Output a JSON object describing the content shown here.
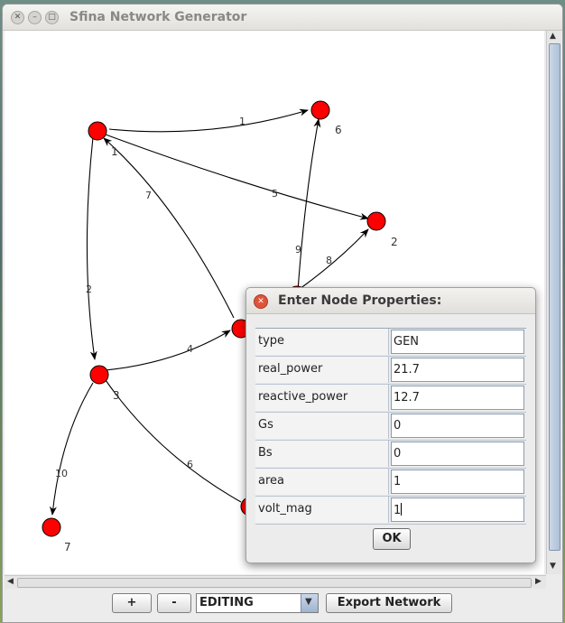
{
  "window": {
    "title": "Sfina Network Generator"
  },
  "graph": {
    "nodes": [
      {
        "id": "1",
        "label": "1"
      },
      {
        "id": "6",
        "label": "6"
      },
      {
        "id": "2",
        "label": "2"
      },
      {
        "id": "3",
        "label": "3"
      },
      {
        "id": "7",
        "label": "7"
      },
      {
        "id": "4",
        "label": ""
      },
      {
        "id": "5",
        "label": ""
      },
      {
        "id": "8",
        "label": ""
      }
    ],
    "edges": [
      {
        "label": "1"
      },
      {
        "label": "5"
      },
      {
        "label": "2"
      },
      {
        "label": "4"
      },
      {
        "label": "6"
      },
      {
        "label": "10"
      },
      {
        "label": "7"
      },
      {
        "label": "9"
      },
      {
        "label": "8"
      }
    ]
  },
  "dialog": {
    "title": "Enter Node Properties:",
    "properties": [
      {
        "key": "type",
        "value": "GEN"
      },
      {
        "key": "real_power",
        "value": "21.7"
      },
      {
        "key": "reactive_power",
        "value": "12.7"
      },
      {
        "key": "Gs",
        "value": "0"
      },
      {
        "key": "Bs",
        "value": "0"
      },
      {
        "key": "area",
        "value": "1"
      },
      {
        "key": "volt_mag",
        "value": "1"
      }
    ],
    "ok_label": "OK"
  },
  "toolbar": {
    "zoom_in_label": "+",
    "zoom_out_label": "-",
    "mode_value": "EDITING",
    "export_label": "Export Network"
  },
  "colors": {
    "node_fill": "#ff0000",
    "node_stroke": "#000000"
  }
}
